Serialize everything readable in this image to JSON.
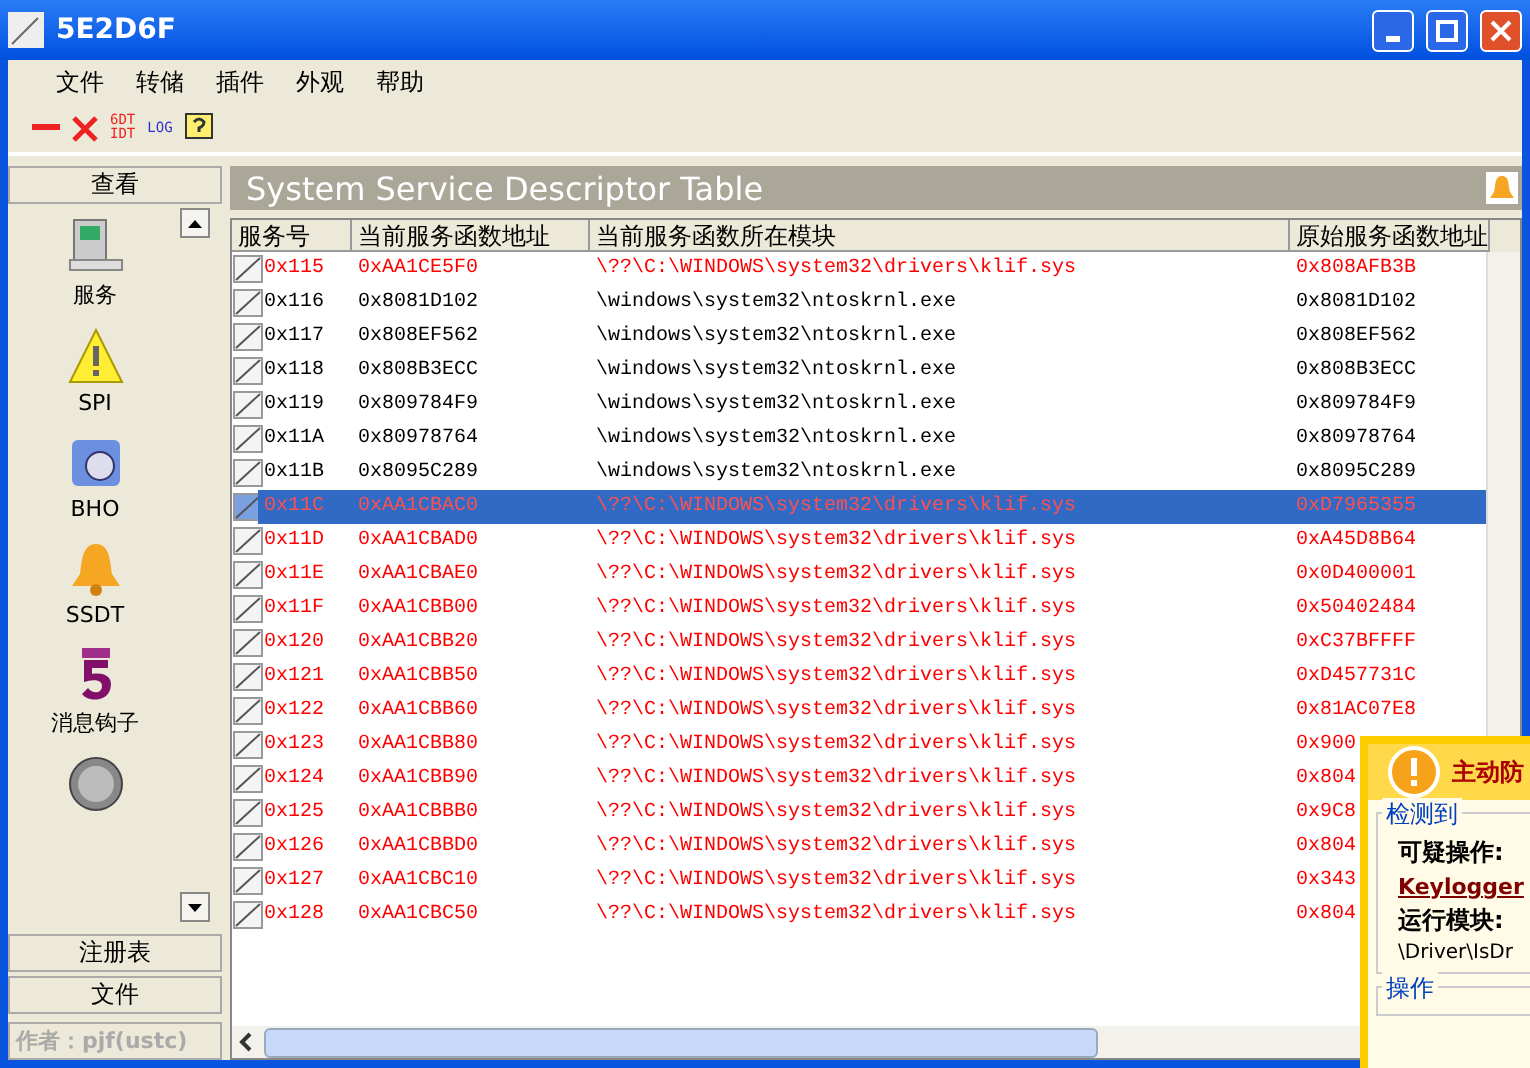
{
  "window": {
    "title": "5E2D6F"
  },
  "menu": [
    "文件",
    "转储",
    "插件",
    "外观",
    "帮助"
  ],
  "toolbar": {
    "buttons": [
      "6DT\nIDT",
      "LOG"
    ]
  },
  "sidebar": {
    "header": "查看",
    "items": [
      {
        "label": "服务"
      },
      {
        "label": "SPI"
      },
      {
        "label": "BHO"
      },
      {
        "label": "SSDT"
      },
      {
        "label": "消息钩子"
      }
    ],
    "footer_buttons": [
      "注册表",
      "文件"
    ]
  },
  "panel": {
    "title": "System Service Descriptor Table"
  },
  "table": {
    "columns": [
      "服务号",
      "当前服务函数地址",
      "当前服务函数所在模块",
      "原始服务函数地址"
    ],
    "rows": [
      {
        "cells": [
          "0x115",
          "0xAA1CE5F0",
          "\\??\\C:\\WINDOWS\\system32\\drivers\\klif.sys",
          "0x808AFB3B"
        ],
        "hooked": true,
        "selected": false
      },
      {
        "cells": [
          "0x116",
          "0x8081D102",
          "\\windows\\system32\\ntoskrnl.exe",
          "0x8081D102"
        ],
        "hooked": false,
        "selected": false
      },
      {
        "cells": [
          "0x117",
          "0x808EF562",
          "\\windows\\system32\\ntoskrnl.exe",
          "0x808EF562"
        ],
        "hooked": false,
        "selected": false
      },
      {
        "cells": [
          "0x118",
          "0x808B3ECC",
          "\\windows\\system32\\ntoskrnl.exe",
          "0x808B3ECC"
        ],
        "hooked": false,
        "selected": false
      },
      {
        "cells": [
          "0x119",
          "0x809784F9",
          "\\windows\\system32\\ntoskrnl.exe",
          "0x809784F9"
        ],
        "hooked": false,
        "selected": false
      },
      {
        "cells": [
          "0x11A",
          "0x80978764",
          "\\windows\\system32\\ntoskrnl.exe",
          "0x80978764"
        ],
        "hooked": false,
        "selected": false
      },
      {
        "cells": [
          "0x11B",
          "0x8095C289",
          "\\windows\\system32\\ntoskrnl.exe",
          "0x8095C289"
        ],
        "hooked": false,
        "selected": false
      },
      {
        "cells": [
          "0x11C",
          "0xAA1CBAC0",
          "\\??\\C:\\WINDOWS\\system32\\drivers\\klif.sys",
          "0xD7965355"
        ],
        "hooked": true,
        "selected": true
      },
      {
        "cells": [
          "0x11D",
          "0xAA1CBAD0",
          "\\??\\C:\\WINDOWS\\system32\\drivers\\klif.sys",
          "0xA45D8B64"
        ],
        "hooked": true,
        "selected": false
      },
      {
        "cells": [
          "0x11E",
          "0xAA1CBAE0",
          "\\??\\C:\\WINDOWS\\system32\\drivers\\klif.sys",
          "0x0D400001"
        ],
        "hooked": true,
        "selected": false
      },
      {
        "cells": [
          "0x11F",
          "0xAA1CBB00",
          "\\??\\C:\\WINDOWS\\system32\\drivers\\klif.sys",
          "0x50402484"
        ],
        "hooked": true,
        "selected": false
      },
      {
        "cells": [
          "0x120",
          "0xAA1CBB20",
          "\\??\\C:\\WINDOWS\\system32\\drivers\\klif.sys",
          "0xC37BFFFF"
        ],
        "hooked": true,
        "selected": false
      },
      {
        "cells": [
          "0x121",
          "0xAA1CBB50",
          "\\??\\C:\\WINDOWS\\system32\\drivers\\klif.sys",
          "0xD457731C"
        ],
        "hooked": true,
        "selected": false
      },
      {
        "cells": [
          "0x122",
          "0xAA1CBB60",
          "\\??\\C:\\WINDOWS\\system32\\drivers\\klif.sys",
          "0x81AC07E8"
        ],
        "hooked": true,
        "selected": false
      },
      {
        "cells": [
          "0x123",
          "0xAA1CBB80",
          "\\??\\C:\\WINDOWS\\system32\\drivers\\klif.sys",
          "0x900"
        ],
        "hooked": true,
        "selected": false
      },
      {
        "cells": [
          "0x124",
          "0xAA1CBB90",
          "\\??\\C:\\WINDOWS\\system32\\drivers\\klif.sys",
          "0x804"
        ],
        "hooked": true,
        "selected": false
      },
      {
        "cells": [
          "0x125",
          "0xAA1CBBB0",
          "\\??\\C:\\WINDOWS\\system32\\drivers\\klif.sys",
          "0x9C8"
        ],
        "hooked": true,
        "selected": false
      },
      {
        "cells": [
          "0x126",
          "0xAA1CBBD0",
          "\\??\\C:\\WINDOWS\\system32\\drivers\\klif.sys",
          "0x804"
        ],
        "hooked": true,
        "selected": false
      },
      {
        "cells": [
          "0x127",
          "0xAA1CBC10",
          "\\??\\C:\\WINDOWS\\system32\\drivers\\klif.sys",
          "0x343"
        ],
        "hooked": true,
        "selected": false
      },
      {
        "cells": [
          "0x128",
          "0xAA1CBC50",
          "\\??\\C:\\WINDOWS\\system32\\drivers\\klif.sys",
          "0x804"
        ],
        "hooked": true,
        "selected": false
      }
    ]
  },
  "status_bar": "作者：pjf(ustc)",
  "alert": {
    "title": "主动防",
    "group": "检测到",
    "action_label": "可疑操作:",
    "action": "Keylogger",
    "module_label": "运行模块:",
    "module": "\\Driver\\IsDr",
    "group2": "操作"
  }
}
